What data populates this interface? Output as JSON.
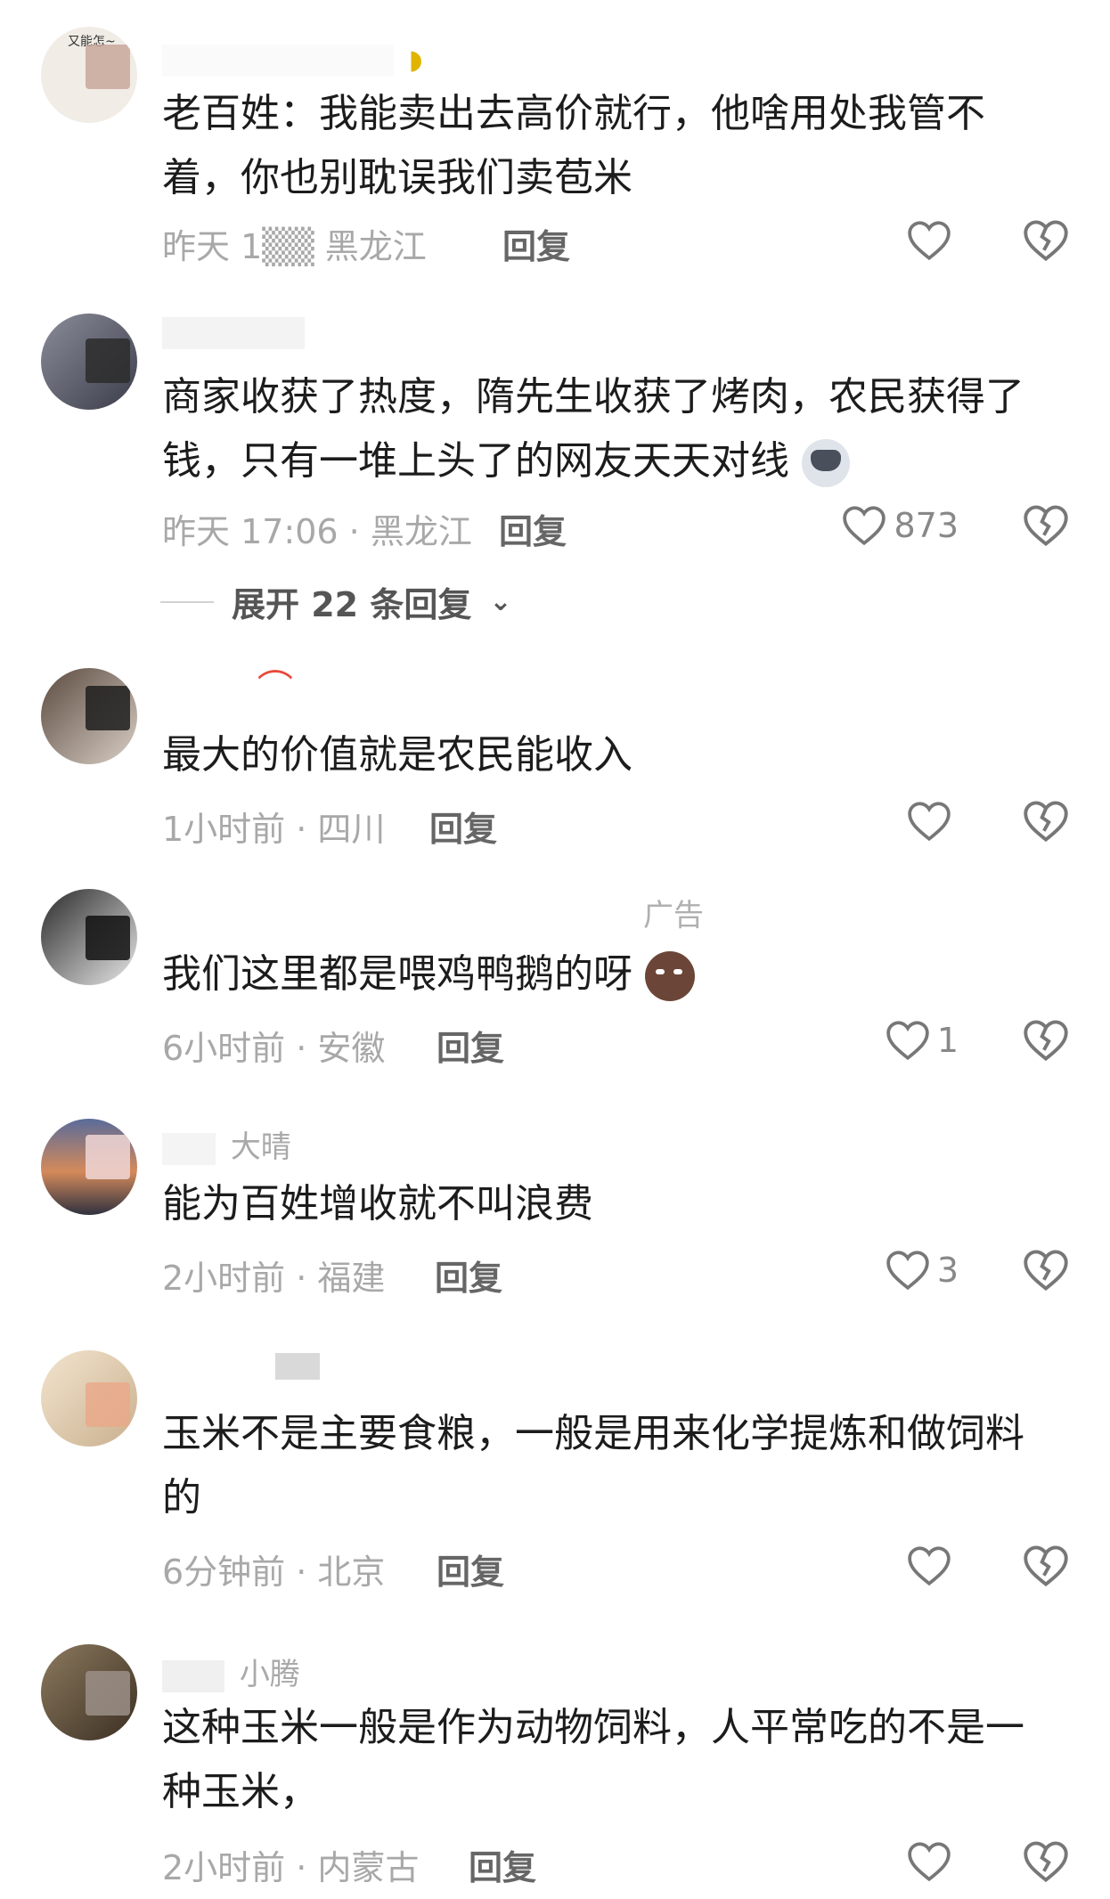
{
  "comments": [
    {
      "username": "",
      "text": "老百姓：我能卖出去高价就行，他啥用处我管不着，你也别耽误我们卖苞米",
      "meta": "昨天 1▒▒ 黑龙江",
      "reply": "回复",
      "likes": ""
    },
    {
      "username": "",
      "text": "商家收获了热度，隋先生收获了烤肉，农民获得了钱，只有一堆上头了的网友天天对线",
      "meta": "昨天 17:06 · 黑龙江",
      "reply": "回复",
      "likes": "873"
    },
    {
      "username": "",
      "text": "最大的价值就是农民能收入",
      "meta": "1小时前 · 四川",
      "reply": "回复",
      "likes": ""
    },
    {
      "username": "",
      "text": "我们这里都是喂鸡鸭鹅的呀",
      "meta": "6小时前 · 安徽",
      "reply": "回复",
      "likes": "1",
      "ad_label": "广告"
    },
    {
      "username": "大晴",
      "text": "能为百姓增收就不叫浪费",
      "meta": "2小时前 · 福建",
      "reply": "回复",
      "likes": "3"
    },
    {
      "username": "",
      "text": "玉米不是主要食粮，一般是用来化学提炼和做饲料的",
      "meta": "6分钟前 · 北京",
      "reply": "回复",
      "likes": ""
    },
    {
      "username": "小腾",
      "text": "这种玉米一般是作为动物饲料，人平常吃的不是一种玉米，",
      "meta": "2小时前 · 内蒙古",
      "reply": "回复",
      "likes": ""
    }
  ],
  "expand_replies": "展开 22 条回复",
  "avatar_badge": "又能怎~",
  "colors": {
    "text": "#1c1c1c",
    "meta": "#a8a8a8",
    "icon": "#777777"
  }
}
